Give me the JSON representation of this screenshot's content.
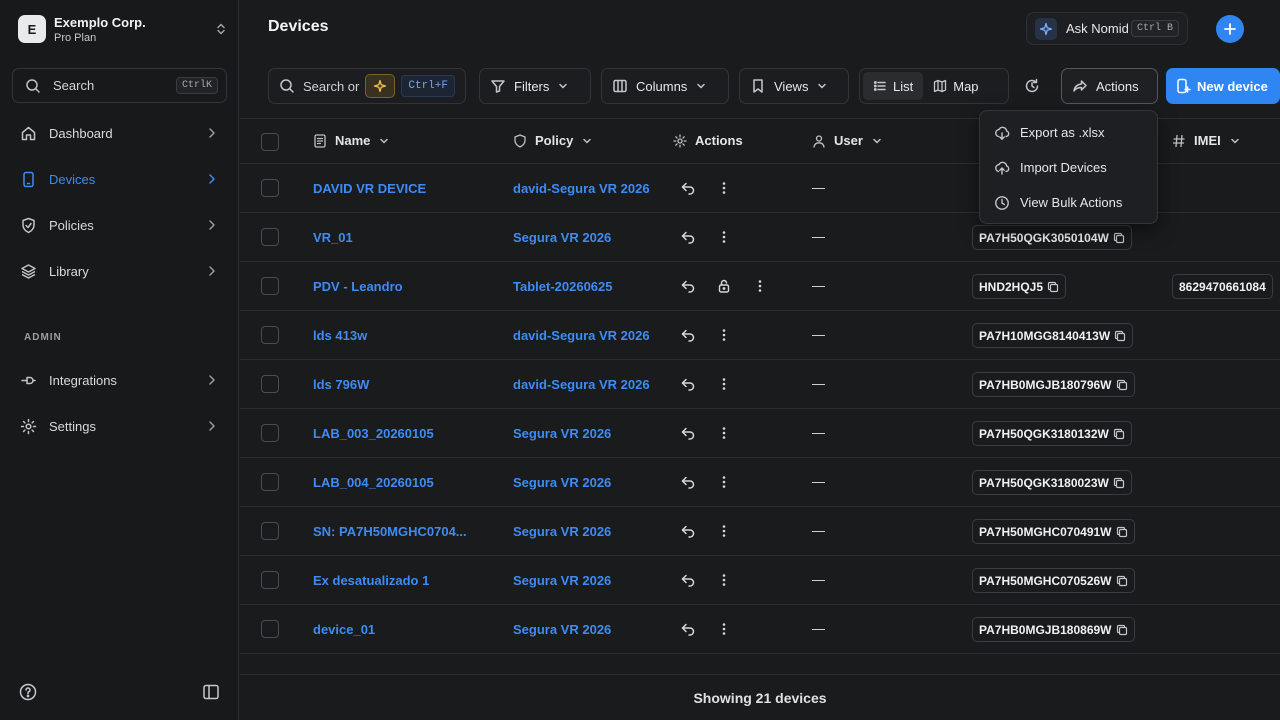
{
  "org": {
    "initial": "E",
    "name": "Exemplo Corp.",
    "plan": "Pro Plan"
  },
  "sidebar": {
    "search_label": "Search",
    "search_shortcut": "CtrlK",
    "items": [
      {
        "label": "Dashboard",
        "icon": "home-icon"
      },
      {
        "label": "Devices",
        "icon": "device-icon"
      },
      {
        "label": "Policies",
        "icon": "shield-icon"
      },
      {
        "label": "Library",
        "icon": "layers-icon"
      }
    ],
    "admin_heading": "ADMIN",
    "admin_items": [
      {
        "label": "Integrations",
        "icon": "integrations-icon"
      },
      {
        "label": "Settings",
        "icon": "gear-icon"
      }
    ]
  },
  "header": {
    "title": "Devices",
    "ask_label": "Ask Nomid",
    "ask_shortcut": "Ctrl B"
  },
  "toolbar": {
    "search_label": "Search or",
    "search_shortcut": "Ctrl+F",
    "filters_label": "Filters",
    "columns_label": "Columns",
    "views_label": "Views",
    "list_label": "List",
    "map_label": "Map",
    "actions_label": "Actions",
    "new_device_label": "New device"
  },
  "actions_menu": {
    "items": [
      "Export as .xlsx",
      "Import Devices",
      "View Bulk Actions"
    ]
  },
  "table": {
    "columns": {
      "name": "Name",
      "policy": "Policy",
      "actions": "Actions",
      "user": "User",
      "imei": "IMEI"
    },
    "rows": [
      {
        "name": "DAVID VR DEVICE",
        "policy": "david-Segura VR 2026",
        "user": "—",
        "serial": "",
        "imei": "",
        "lock": false
      },
      {
        "name": "VR_01",
        "policy": "Segura VR 2026",
        "user": "—",
        "serial": "PA7H50QGK3050104W",
        "imei": "",
        "lock": false
      },
      {
        "name": "PDV - Leandro",
        "policy": "Tablet-20260625",
        "user": "—",
        "serial": "HND2HQJ5",
        "imei": "8629470661084",
        "lock": true
      },
      {
        "name": "lds 413w",
        "policy": "david-Segura VR 2026",
        "user": "—",
        "serial": "PA7H10MGG8140413W",
        "imei": "",
        "lock": false
      },
      {
        "name": "lds 796W",
        "policy": "david-Segura VR 2026",
        "user": "—",
        "serial": "PA7HB0MGJB180796W",
        "imei": "",
        "lock": false
      },
      {
        "name": "LAB_003_20260105",
        "policy": "Segura VR 2026",
        "user": "—",
        "serial": "PA7H50QGK3180132W",
        "imei": "",
        "lock": false
      },
      {
        "name": "LAB_004_20260105",
        "policy": "Segura VR 2026",
        "user": "—",
        "serial": "PA7H50QGK3180023W",
        "imei": "",
        "lock": false
      },
      {
        "name": "SN: PA7H50MGHC0704...",
        "policy": "Segura VR 2026",
        "user": "—",
        "serial": "PA7H50MGHC070491W",
        "imei": "",
        "lock": false
      },
      {
        "name": "Ex desatualizado 1",
        "policy": "Segura VR 2026",
        "user": "—",
        "serial": "PA7H50MGHC070526W",
        "imei": "",
        "lock": false
      },
      {
        "name": "device_01",
        "policy": "Segura VR 2026",
        "user": "—",
        "serial": "PA7HB0MGJB180869W",
        "imei": "",
        "lock": false
      }
    ]
  },
  "footer": {
    "status": "Showing 21 devices"
  },
  "colors": {
    "accent": "#3d8cf5",
    "primary_button": "#2f86f2",
    "background": "#1a1b1d"
  }
}
